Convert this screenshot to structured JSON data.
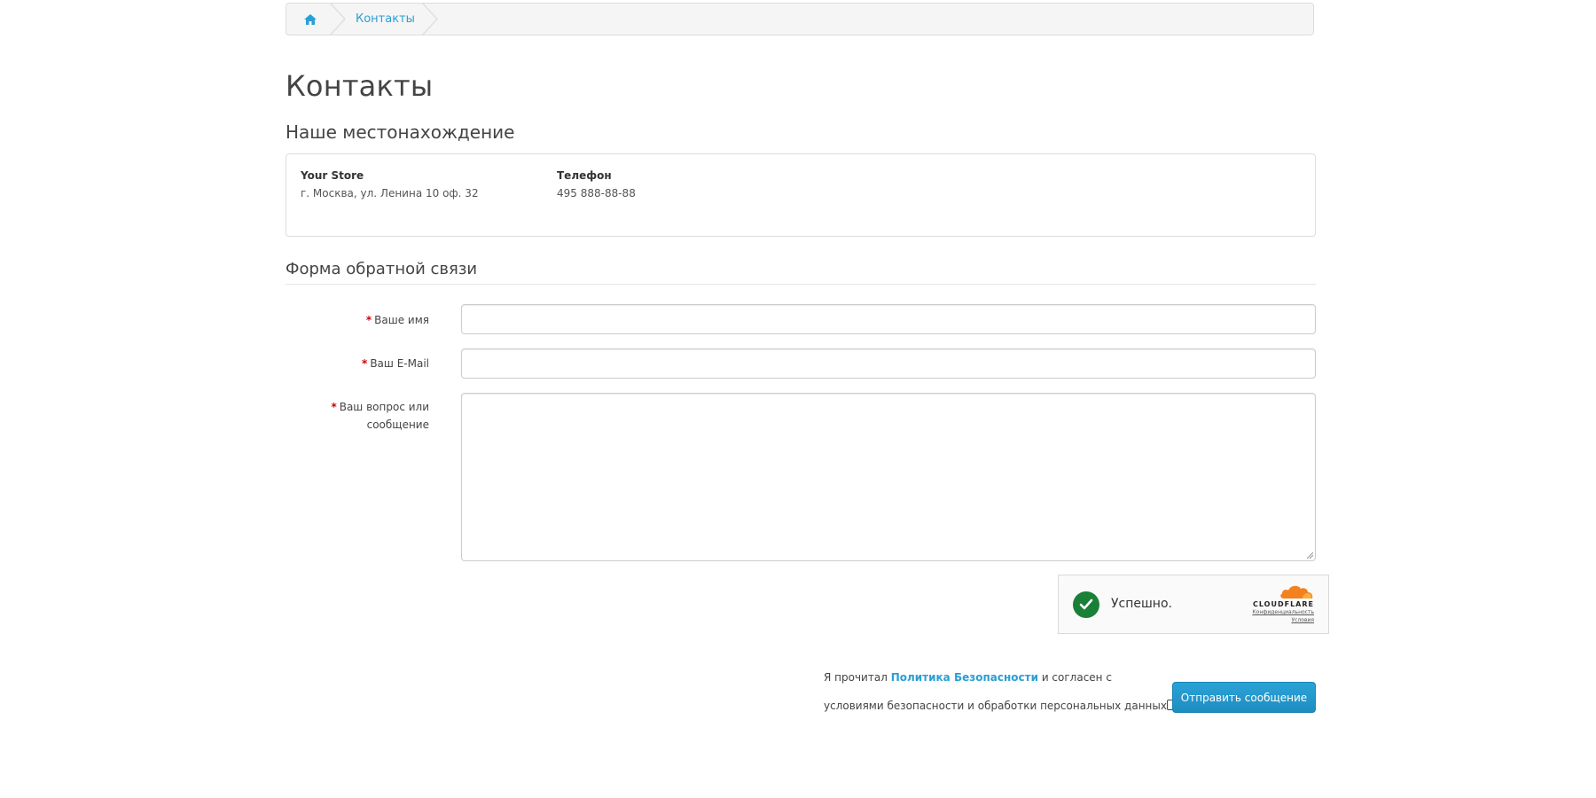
{
  "breadcrumb": {
    "home_icon": "home-icon",
    "current": "Контакты"
  },
  "page_title": "Контакты",
  "location": {
    "section_title": "Наше местонахождение",
    "store_name": "Your Store",
    "address": "г. Москва, ул. Ленина 10 оф. 32",
    "phone_label": "Телефон",
    "phone": "495 888-88-88"
  },
  "form": {
    "legend": "Форма обратной связи",
    "required_mark": "*",
    "name_label": "Ваше имя",
    "name_value": "",
    "email_label": "Ваш E-Mail",
    "email_value": "",
    "message_label_line1": "Ваш вопрос или",
    "message_label_line2": "сообщение",
    "message_value": ""
  },
  "captcha": {
    "status": "Успешно.",
    "brand": "CLOUDFLARE",
    "privacy_link": "Конфиденциальность",
    "terms_link": "Условия",
    "check_color": "#1a7f37",
    "brand_color": "#f48120"
  },
  "consent": {
    "text_before": "Я прочитал",
    "policy_link": "Политика Безопасности",
    "text_after": "и согласен с",
    "text_line2": "условиями безопасности и обработки персональных данных",
    "checked": false
  },
  "submit_label": "Отправить сообщение",
  "colors": {
    "accent": "#2a9fd6",
    "button": "#1e8dc0",
    "required": "#cc0000"
  }
}
